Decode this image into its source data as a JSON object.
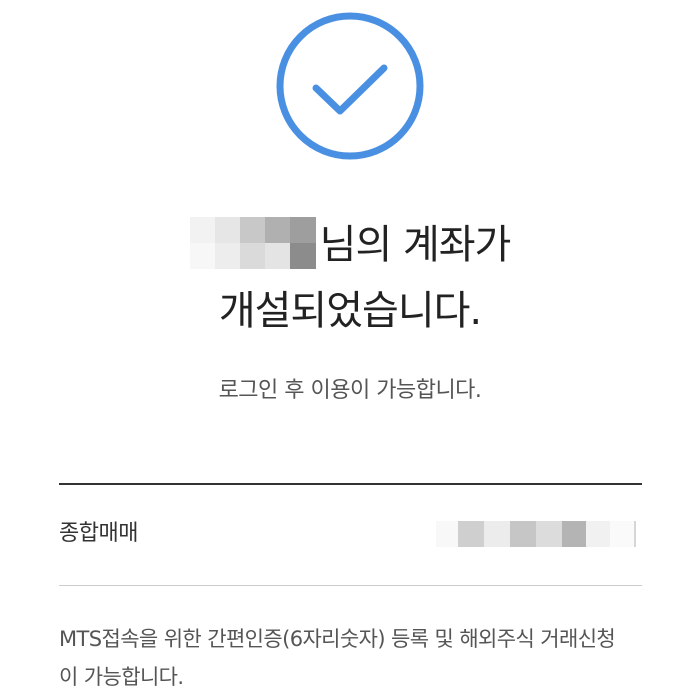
{
  "status": {
    "icon": "check-circle-icon",
    "accent_color": "#4A90E2"
  },
  "headline": {
    "name_suffix": "님의 계좌가",
    "line2": "개설되었습니다."
  },
  "subtitle": "로그인 후 이용이 가능합니다.",
  "account": {
    "label": "종합매매"
  },
  "notice": {
    "line1": "MTS접속을 위한 간편인증(6자리숫자) 등록 및 해외주식 거래신청",
    "line2": "이 가능합니다."
  }
}
